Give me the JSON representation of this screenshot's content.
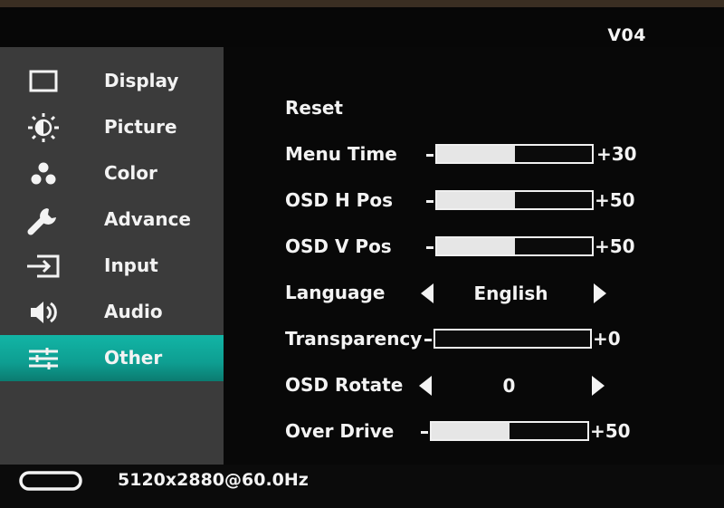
{
  "header": {
    "version": "V04"
  },
  "sidebar": {
    "items": [
      {
        "label": "Display",
        "icon": "display-icon"
      },
      {
        "label": "Picture",
        "icon": "brightness-icon"
      },
      {
        "label": "Color",
        "icon": "color-dots-icon"
      },
      {
        "label": "Advance",
        "icon": "wrench-icon"
      },
      {
        "label": "Input",
        "icon": "input-icon"
      },
      {
        "label": "Audio",
        "icon": "speaker-icon"
      },
      {
        "label": "Other",
        "icon": "sliders-icon",
        "active": true
      }
    ]
  },
  "settings": {
    "reset": {
      "label": "Reset"
    },
    "menu_time": {
      "label": "Menu Time",
      "value": "+30",
      "level": 0.5
    },
    "osd_h_pos": {
      "label": "OSD H Pos",
      "value": "+50",
      "level": 0.5
    },
    "osd_v_pos": {
      "label": "OSD V Pos",
      "value": "+50",
      "level": 0.5
    },
    "language": {
      "label": "Language",
      "value": "English"
    },
    "transparency": {
      "label": "Transparency",
      "value": "+0",
      "level": 0
    },
    "osd_rotate": {
      "label": "OSD Rotate",
      "value": "0"
    },
    "over_drive": {
      "label": "Over Drive",
      "value": "+50",
      "level": 0.5
    }
  },
  "footer": {
    "resolution": "5120x2880@60.0Hz",
    "icon": "connector-icon"
  },
  "colors": {
    "accent": "#12b5a6",
    "sidebar": "#3b3b3b",
    "panel": "#080808"
  }
}
